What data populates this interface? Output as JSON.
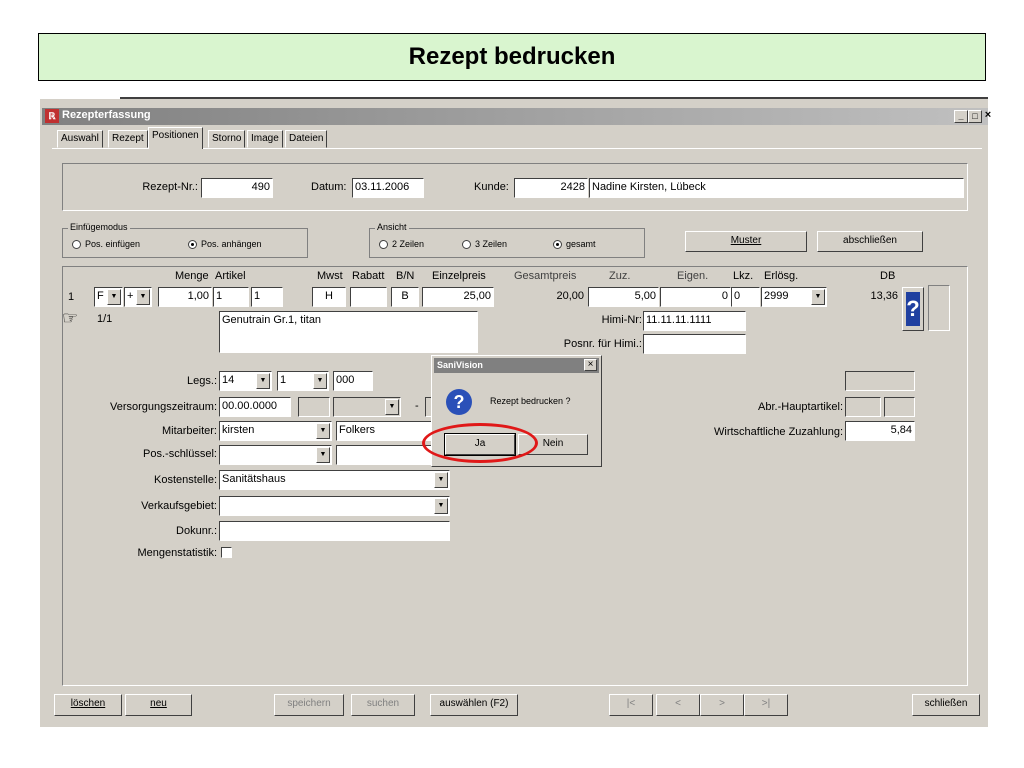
{
  "slide": {
    "title": "Rezept bedrucken"
  },
  "window": {
    "title": "Rezepterfassung",
    "min": "_",
    "max": "□",
    "close": "×"
  },
  "tabs": [
    "Auswahl",
    "Rezept",
    "Positionen",
    "Storno",
    "Image",
    "Dateien"
  ],
  "active_tab": "Positionen",
  "header": {
    "rezept_nr_label": "Rezept-Nr.:",
    "rezept_nr": "490",
    "datum_label": "Datum:",
    "datum": "03.11.2006",
    "kunde_label": "Kunde:",
    "kunde_nr": "2428",
    "kunde_name": "Nadine Kirsten, Lübeck"
  },
  "einfuegemodus": {
    "title": "Einfügemodus",
    "options": [
      "Pos. einfügen",
      "Pos. anhängen"
    ],
    "selected": "Pos. anhängen"
  },
  "ansicht": {
    "title": "Ansicht",
    "options": [
      "2 Zeilen",
      "3 Zeilen",
      "gesamt"
    ],
    "selected": "gesamt"
  },
  "buttons_top": {
    "muster": "Muster",
    "abschliessen": "abschließen"
  },
  "columns": [
    "Menge",
    "Artikel",
    "Mwst",
    "Rabatt",
    "B/N",
    "Einzelpreis",
    "Gesamtpreis",
    "Zuz.",
    "Eigen.",
    "Lkz.",
    "Erlösg.",
    "DB"
  ],
  "row": {
    "nr": "1",
    "f": "F",
    "plus": "+",
    "menge": "1,00",
    "artikel1": "1",
    "artikel2": "1",
    "mwst": "H",
    "rabatt": "",
    "bn": "B",
    "einzelpreis": "25,00",
    "gesamtpreis": "20,00",
    "zuz": "5,00",
    "eigen": "0",
    "lkz": "0",
    "erloesg": "2999",
    "db": "13,36",
    "sub": "1/1",
    "beschreibung": "Genutrain Gr.1, titan",
    "himi_nr_label": "Himi-Nr:",
    "himi_nr": "11.11.11.1111",
    "posnr_himi_label": "Posnr. für Himi.:",
    "posnr_himi": ""
  },
  "details": {
    "legs_label": "Legs.:",
    "legs1": "14",
    "legs2": "1",
    "legs3": "000",
    "versorgung_label": "Versorgungszeitraum:",
    "versorgung": "00.00.0000",
    "versorgung_sep": "-",
    "mitarbeiter_label": "Mitarbeiter:",
    "mitarbeiter": "kirsten",
    "mitarbeiter2": "Folkers",
    "posschluessel_label": "Pos.-schlüssel:",
    "kostenstelle_label": "Kostenstelle:",
    "kostenstelle": "Sanitätshaus",
    "verkaufsgebiet_label": "Verkaufsgebiet:",
    "dokunr_label": "Dokunr.:",
    "mengenstatistik_label": "Mengenstatistik:",
    "abr_label": "Abr.-Hauptartikel:",
    "wz_label": "Wirtschaftliche Zuzahlung:",
    "wz": "5,84"
  },
  "dialog": {
    "title": "SaniVision",
    "close": "×",
    "message": "Rezept bedrucken ?",
    "yes": "Ja",
    "no": "Nein",
    "icon": "?"
  },
  "bottom_buttons": {
    "loeschen": "löschen",
    "neu": "neu",
    "speichern": "speichern",
    "suchen": "suchen",
    "auswaehlen": "auswählen (F2)",
    "first": "|<",
    "prev": "<",
    "next": ">",
    "last": ">|",
    "schliessen": "schließen"
  },
  "colors": {
    "window_bg": "#d4d0c8",
    "slide_title_bg": "#d9f5cf",
    "highlight": "#e01818"
  }
}
